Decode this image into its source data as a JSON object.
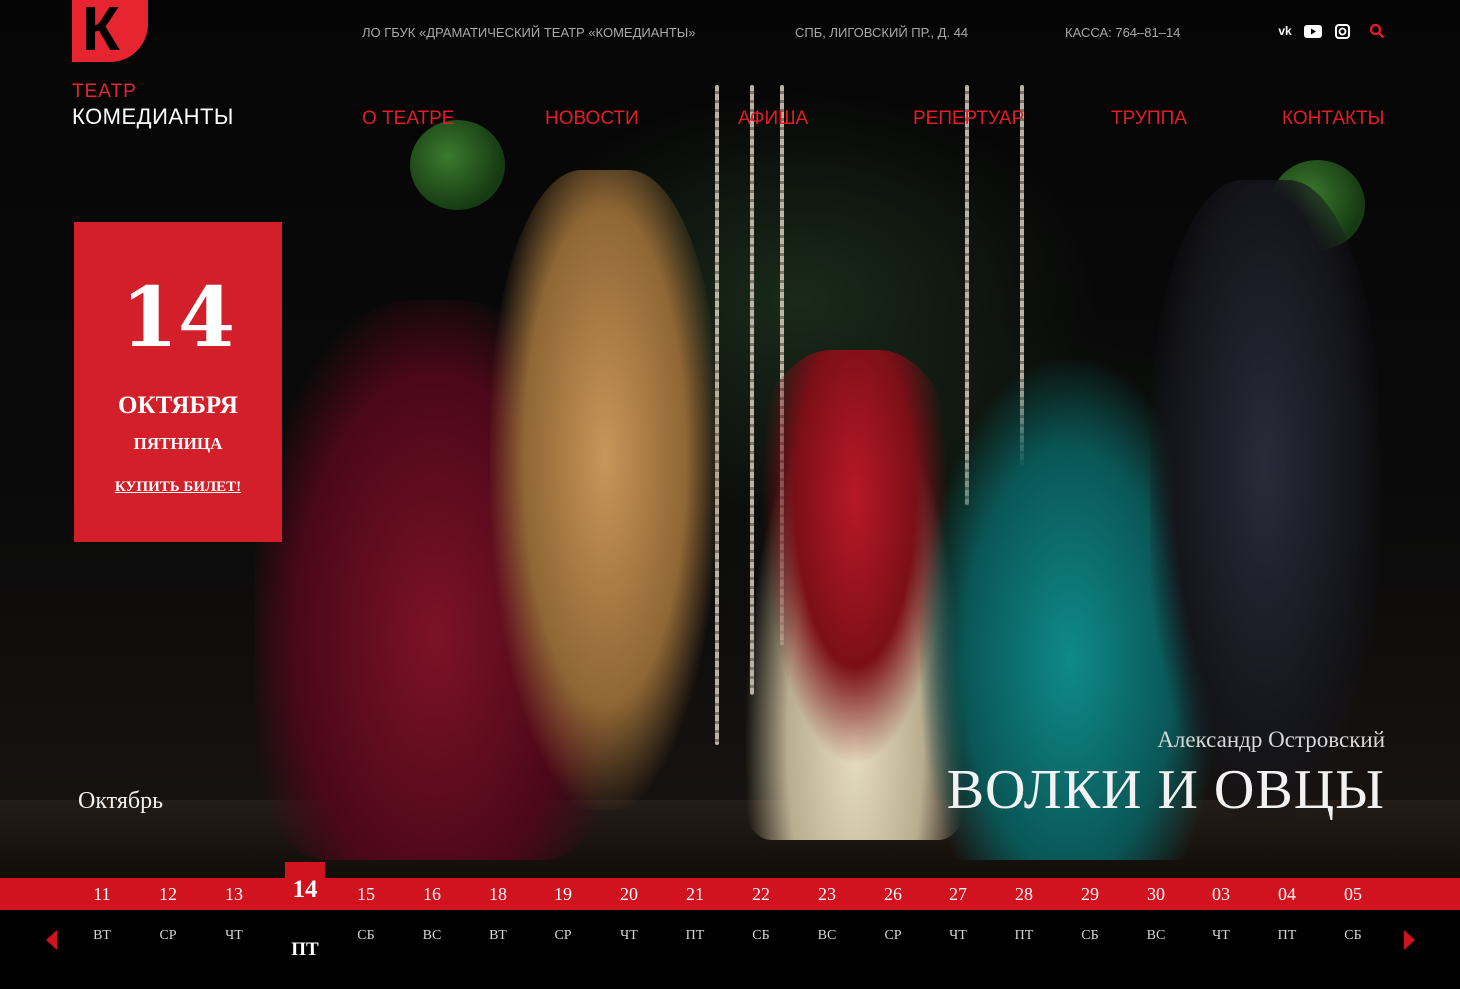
{
  "brand": {
    "mark": "К",
    "line1": "ТЕАТР",
    "line2": "КОМЕДИАНТЫ"
  },
  "topbar": {
    "org": "ЛО ГБУК «ДРАМАТИЧЕСКИЙ ТЕАТР «КОМЕДИАНТЫ»",
    "address": "СПБ, ЛИГОВСКИЙ ПР., Д. 44",
    "phone": "КАССА: 764–81–14"
  },
  "social": [
    "vk-icon",
    "youtube-icon",
    "instagram-icon",
    "search-icon"
  ],
  "nav": [
    "О ТЕАТРЕ",
    "НОВОСТИ",
    "АФИША",
    "РЕПЕРТУАР",
    "ТРУППА",
    "КОНТАКТЫ"
  ],
  "event": {
    "day": "14",
    "month": "ОКТЯБРЯ",
    "weekday": "ПЯТНИЦА",
    "buy_label": "КУПИТЬ БИЛЕТ!",
    "author": "Александр Островский",
    "title": "ВОЛКИ И ОВЦЫ"
  },
  "calendar": {
    "month_label": "Октябрь",
    "active": {
      "day": "14",
      "weekday": "ПТ"
    },
    "days": [
      {
        "day": "11",
        "weekday": "ВТ"
      },
      {
        "day": "12",
        "weekday": "СР"
      },
      {
        "day": "13",
        "weekday": "ЧТ"
      },
      {
        "day": "15",
        "weekday": "СБ"
      },
      {
        "day": "16",
        "weekday": "ВС"
      },
      {
        "day": "18",
        "weekday": "ВТ"
      },
      {
        "day": "19",
        "weekday": "СР"
      },
      {
        "day": "20",
        "weekday": "ЧТ"
      },
      {
        "day": "21",
        "weekday": "ПТ"
      },
      {
        "day": "22",
        "weekday": "СБ"
      },
      {
        "day": "23",
        "weekday": "ВС"
      },
      {
        "day": "26",
        "weekday": "СР"
      },
      {
        "day": "27",
        "weekday": "ЧТ"
      },
      {
        "day": "28",
        "weekday": "ПТ"
      },
      {
        "day": "29",
        "weekday": "СБ"
      },
      {
        "day": "30",
        "weekday": "ВС"
      },
      {
        "day": "03",
        "weekday": "ЧТ"
      },
      {
        "day": "04",
        "weekday": "ПТ"
      },
      {
        "day": "05",
        "weekday": "СБ"
      }
    ]
  },
  "colors": {
    "accent": "#d0131f",
    "nav": "#e21e24",
    "background": "#000000"
  }
}
